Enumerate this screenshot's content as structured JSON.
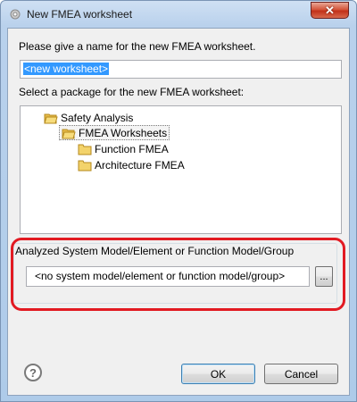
{
  "window": {
    "title": "New FMEA worksheet",
    "close_label": "✕"
  },
  "form": {
    "name_prompt": "Please give a name for the new FMEA worksheet.",
    "name_value": "<new worksheet>",
    "package_prompt": "Select a package for the new FMEA worksheet:"
  },
  "tree": {
    "items": [
      {
        "label": "Safety Analysis",
        "level": 0
      },
      {
        "label": "FMEA Worksheets",
        "level": 1,
        "selected": true
      },
      {
        "label": "Function FMEA",
        "level": 2
      },
      {
        "label": "Architecture FMEA",
        "level": 2
      }
    ]
  },
  "analyzed": {
    "group_title": "Analyzed System Model/Element or Function Model/Group",
    "value": "<no system model/element or function model/group>",
    "browse_label": "..."
  },
  "footer": {
    "help_label": "?",
    "ok_label": "OK",
    "cancel_label": "Cancel"
  },
  "colors": {
    "highlight": "#e21a22",
    "selection": "#3399ff",
    "folder": "#f3d36b"
  }
}
